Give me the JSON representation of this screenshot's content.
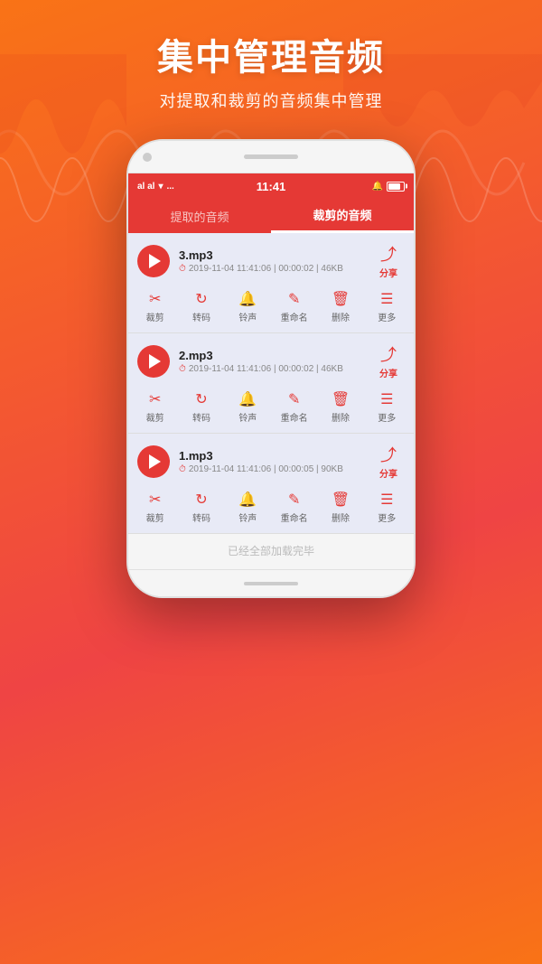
{
  "header": {
    "main_title": "集中管理音频",
    "sub_title": "对提取和裁剪的音频集中管理"
  },
  "status_bar": {
    "signal": "աl աl",
    "wifi": "WiFi",
    "dots": "...",
    "time": "11:41",
    "bell": "🔔",
    "battery": "battery"
  },
  "tabs": [
    {
      "label": "提取的音频",
      "active": false
    },
    {
      "label": "裁剪的音频",
      "active": true
    }
  ],
  "audio_files": [
    {
      "filename": "3.mp3",
      "meta": "2019-11-04 11:41:06 | 00:00:02 | 46KB",
      "share_label": "分享",
      "actions": [
        {
          "icon": "✂",
          "label": "裁剪"
        },
        {
          "icon": "↻",
          "label": "转码"
        },
        {
          "icon": "♪",
          "label": "铃声"
        },
        {
          "icon": "✎",
          "label": "重命名"
        },
        {
          "icon": "⊘",
          "label": "删除"
        },
        {
          "icon": "≡",
          "label": "更多"
        }
      ]
    },
    {
      "filename": "2.mp3",
      "meta": "2019-11-04 11:41:06 | 00:00:02 | 46KB",
      "share_label": "分享",
      "actions": [
        {
          "icon": "✂",
          "label": "裁剪"
        },
        {
          "icon": "↻",
          "label": "转码"
        },
        {
          "icon": "♪",
          "label": "铃声"
        },
        {
          "icon": "✎",
          "label": "重命名"
        },
        {
          "icon": "⊘",
          "label": "删除"
        },
        {
          "icon": "≡",
          "label": "更多"
        }
      ]
    },
    {
      "filename": "1.mp3",
      "meta": "2019-11-04 11:41:06 | 00:00:05 | 90KB",
      "share_label": "分享",
      "actions": [
        {
          "icon": "✂",
          "label": "裁剪"
        },
        {
          "icon": "↻",
          "label": "转码"
        },
        {
          "icon": "♪",
          "label": "铃声"
        },
        {
          "icon": "✎",
          "label": "重命名"
        },
        {
          "icon": "⊘",
          "label": "删除"
        },
        {
          "icon": "≡",
          "label": "更多"
        }
      ]
    }
  ],
  "loaded_text": "已经全部加载完毕",
  "action_icons": {
    "crop": "✂",
    "transcode": "↺",
    "ringtone": "♪",
    "rename": "✎",
    "delete": "🗑",
    "more": "☰"
  }
}
